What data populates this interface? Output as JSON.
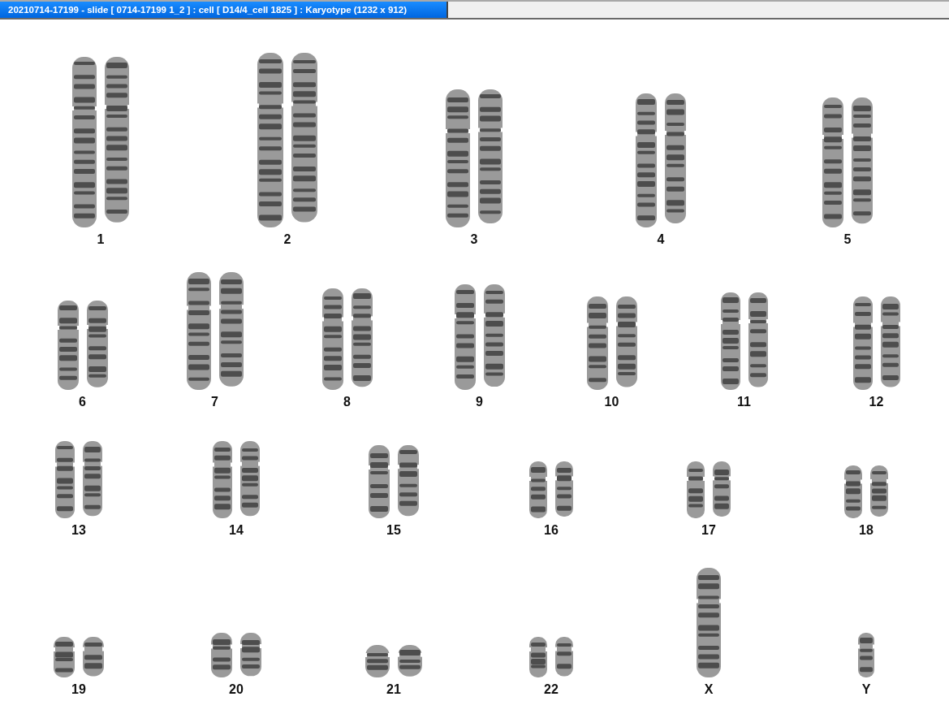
{
  "window": {
    "title": "20210714-17199 - slide [ 0714-17199 1_2 ] : cell [ D14/4_cell 1825 ] : Karyotype  (1232 x 912)"
  },
  "karyotype": {
    "rows": [
      {
        "pairs": [
          {
            "label": "1"
          },
          {
            "label": "2"
          },
          {
            "label": "3"
          },
          {
            "label": "4"
          },
          {
            "label": "5"
          }
        ]
      },
      {
        "pairs": [
          {
            "label": "6"
          },
          {
            "label": "7"
          },
          {
            "label": "8"
          },
          {
            "label": "9"
          },
          {
            "label": "10"
          },
          {
            "label": "11"
          },
          {
            "label": "12"
          }
        ]
      },
      {
        "pairs": [
          {
            "label": "13"
          },
          {
            "label": "14"
          },
          {
            "label": "15"
          },
          {
            "label": "16"
          },
          {
            "label": "17"
          },
          {
            "label": "18"
          }
        ]
      },
      {
        "pairs": [
          {
            "label": "19"
          },
          {
            "label": "20"
          },
          {
            "label": "21"
          },
          {
            "label": "22"
          },
          {
            "label": "X"
          },
          {
            "label": "Y"
          }
        ]
      }
    ]
  }
}
